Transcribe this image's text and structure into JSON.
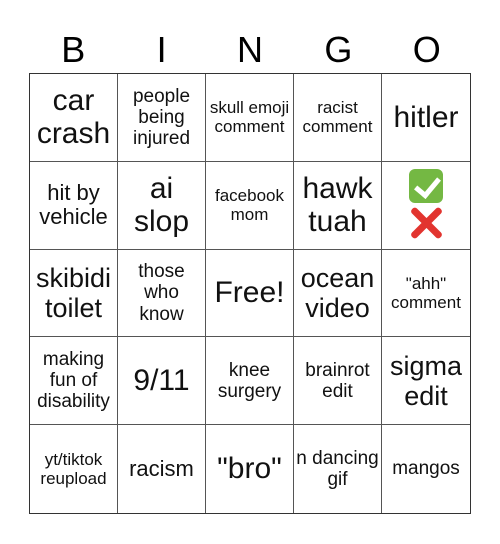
{
  "header": [
    "B",
    "I",
    "N",
    "G",
    "O"
  ],
  "cells": [
    {
      "text": "car crash",
      "size": "s-xl"
    },
    {
      "text": "people being injured",
      "size": "s-s"
    },
    {
      "text": "skull emoji comment",
      "size": "s-xs"
    },
    {
      "text": "racist comment",
      "size": "s-xs"
    },
    {
      "text": "hitler",
      "size": "s-xl"
    },
    {
      "text": "hit by vehicle",
      "size": "s-m"
    },
    {
      "text": "ai slop",
      "size": "s-xl"
    },
    {
      "text": "facebook mom",
      "size": "s-xs"
    },
    {
      "text": "hawk tuah",
      "size": "s-xl"
    },
    {
      "text": "",
      "size": "s-xl",
      "emoji": [
        "check-mark-button-icon",
        "cross-mark-icon"
      ]
    },
    {
      "text": "skibidi toilet",
      "size": "s-l"
    },
    {
      "text": "those who know",
      "size": "s-s"
    },
    {
      "text": "Free!",
      "size": "s-xl",
      "free": true
    },
    {
      "text": "ocean video",
      "size": "s-l"
    },
    {
      "text": "\"ahh\" comment",
      "size": "s-xs"
    },
    {
      "text": "making fun of disability",
      "size": "s-s"
    },
    {
      "text": "9/11",
      "size": "s-xl"
    },
    {
      "text": "knee surgery",
      "size": "s-s"
    },
    {
      "text": "brainrot edit",
      "size": "s-s"
    },
    {
      "text": "sigma edit",
      "size": "s-l"
    },
    {
      "text": "yt/tiktok reupload",
      "size": "s-xs"
    },
    {
      "text": "racism",
      "size": "s-m"
    },
    {
      "text": "\"bro\"",
      "size": "s-xl"
    },
    {
      "text": "n dancing gif",
      "size": "s-s"
    },
    {
      "text": "mangos",
      "size": "s-s"
    }
  ]
}
